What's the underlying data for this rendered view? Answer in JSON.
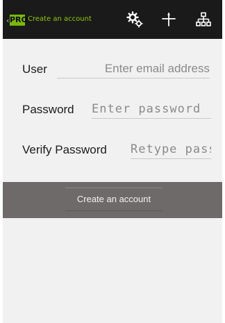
{
  "action_bar": {
    "up_caret": "‹",
    "pro_badge": "PRO",
    "title": "Create an account",
    "icons": [
      "settings-gears-icon",
      "pin-crosshair-icon",
      "sitemap-icon"
    ],
    "accent_color": "#8ec800",
    "badge_color": "#7ab800"
  },
  "form": {
    "user": {
      "label": "User",
      "placeholder": "Enter email address"
    },
    "password": {
      "label": "Password",
      "placeholder": "Enter password"
    },
    "verify": {
      "label": "Verify Password",
      "placeholder": "Retype password"
    }
  },
  "actions": {
    "create_button": "Create an account"
  }
}
